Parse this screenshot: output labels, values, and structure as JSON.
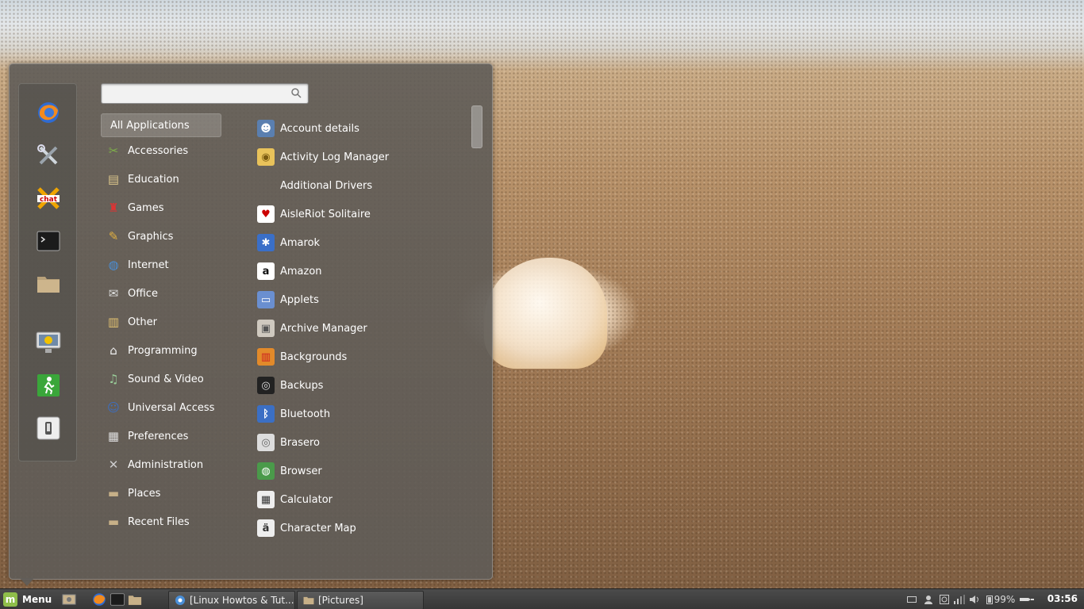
{
  "search": {
    "value": "",
    "placeholder": ""
  },
  "favorites": [
    {
      "name": "firefox-icon"
    },
    {
      "name": "settings-tools-icon"
    },
    {
      "name": "hexchat-icon"
    },
    {
      "name": "terminal-icon"
    },
    {
      "name": "folder-icon"
    },
    {
      "name": "lock-screen-icon"
    },
    {
      "name": "logout-icon"
    },
    {
      "name": "shutdown-icon"
    }
  ],
  "categories": [
    {
      "label": "All Applications",
      "icon": ""
    },
    {
      "label": "Accessories",
      "icon": "accessories-icon"
    },
    {
      "label": "Education",
      "icon": "education-icon"
    },
    {
      "label": "Games",
      "icon": "games-icon"
    },
    {
      "label": "Graphics",
      "icon": "graphics-icon"
    },
    {
      "label": "Internet",
      "icon": "internet-icon"
    },
    {
      "label": "Office",
      "icon": "office-icon"
    },
    {
      "label": "Other",
      "icon": "other-icon"
    },
    {
      "label": "Programming",
      "icon": "programming-icon"
    },
    {
      "label": "Sound & Video",
      "icon": "sound-video-icon"
    },
    {
      "label": "Universal Access",
      "icon": "universal-access-icon"
    },
    {
      "label": "Preferences",
      "icon": "preferences-icon"
    },
    {
      "label": "Administration",
      "icon": "administration-icon"
    },
    {
      "label": "Places",
      "icon": "places-folder-icon"
    },
    {
      "label": "Recent Files",
      "icon": "recent-files-folder-icon"
    }
  ],
  "apps": [
    {
      "label": "Account details",
      "icon": "account-icon"
    },
    {
      "label": "Activity Log Manager",
      "icon": "activity-log-icon"
    },
    {
      "label": "Additional Drivers",
      "icon": ""
    },
    {
      "label": "AisleRiot Solitaire",
      "icon": "solitaire-icon"
    },
    {
      "label": "Amarok",
      "icon": "amarok-icon"
    },
    {
      "label": "Amazon",
      "icon": "amazon-icon"
    },
    {
      "label": "Applets",
      "icon": "applets-icon"
    },
    {
      "label": "Archive Manager",
      "icon": "archive-icon"
    },
    {
      "label": "Backgrounds",
      "icon": "backgrounds-icon"
    },
    {
      "label": "Backups",
      "icon": "backups-icon"
    },
    {
      "label": "Bluetooth",
      "icon": "bluetooth-icon"
    },
    {
      "label": "Brasero",
      "icon": "brasero-icon"
    },
    {
      "label": "Browser",
      "icon": "browser-icon"
    },
    {
      "label": "Calculator",
      "icon": "calculator-icon"
    },
    {
      "label": "Character Map",
      "icon": "character-map-icon"
    }
  ],
  "panel": {
    "menu_label": "Menu",
    "tasks": [
      {
        "label": "[Linux Howtos & Tut...",
        "icon": "chromium-icon"
      },
      {
        "label": "[Pictures]",
        "icon": "folder-icon"
      }
    ],
    "battery": "99%",
    "clock": "03:56"
  }
}
